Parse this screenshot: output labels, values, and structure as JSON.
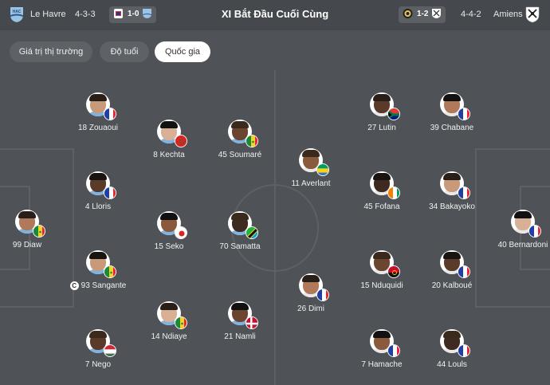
{
  "header": {
    "home_team": "Le Havre",
    "home_formation": "4-3-3",
    "title": "XI Bắt Đầu Cuối Cùng",
    "away_team": "Amiens",
    "away_formation": "4-4-2",
    "left_score": "1-0",
    "right_score": "1-2"
  },
  "tabs": [
    {
      "label": "Giá trị thị trường",
      "active": false
    },
    {
      "label": "Độ tuổi",
      "active": false
    },
    {
      "label": "Quốc gia",
      "active": true
    }
  ],
  "colors": {
    "background": "#4f5357",
    "pitch_lines": "#5d6165",
    "header": "#45494d"
  },
  "home_players": [
    {
      "label": "18 Zouaoui",
      "flag": "france-flag"
    },
    {
      "label": "8 Kechta",
      "flag": "morocco-flag"
    },
    {
      "label": "45 Soumaré",
      "flag": "senegal-flag"
    },
    {
      "label": "4 Lloris",
      "flag": "france-flag"
    },
    {
      "label": "99 Diaw",
      "flag": "senegal-flag"
    },
    {
      "label": "15 Seko",
      "flag": "japan-flag"
    },
    {
      "label": "70 Samatta",
      "flag": "tanzania-flag"
    },
    {
      "label": "93 Sangante",
      "flag": "senegal-flag",
      "captain": "C"
    },
    {
      "label": "14 Ndiaye",
      "flag": "senegal-flag"
    },
    {
      "label": "21 Namli",
      "flag": "denmark-flag"
    },
    {
      "label": "7 Nego",
      "flag": "hungary-flag"
    }
  ],
  "away_players": [
    {
      "label": "27 Lutin",
      "flag": "south-africa-flag"
    },
    {
      "label": "39 Chabane",
      "flag": "france-flag"
    },
    {
      "label": "11 Averlant",
      "flag": "gabon-flag"
    },
    {
      "label": "45 Fofana",
      "flag": "ivory-coast-flag"
    },
    {
      "label": "34 Bakayoko",
      "flag": "france-flag"
    },
    {
      "label": "40 Bernardoni",
      "flag": "france-flag"
    },
    {
      "label": "15 Nduquidi",
      "flag": "angola-flag"
    },
    {
      "label": "20 Kalboué",
      "flag": "france-flag"
    },
    {
      "label": "26 Dimi",
      "flag": "france-flag"
    },
    {
      "label": "7 Hamache",
      "flag": "france-flag"
    },
    {
      "label": "44 Louls",
      "flag": "france-flag"
    }
  ]
}
